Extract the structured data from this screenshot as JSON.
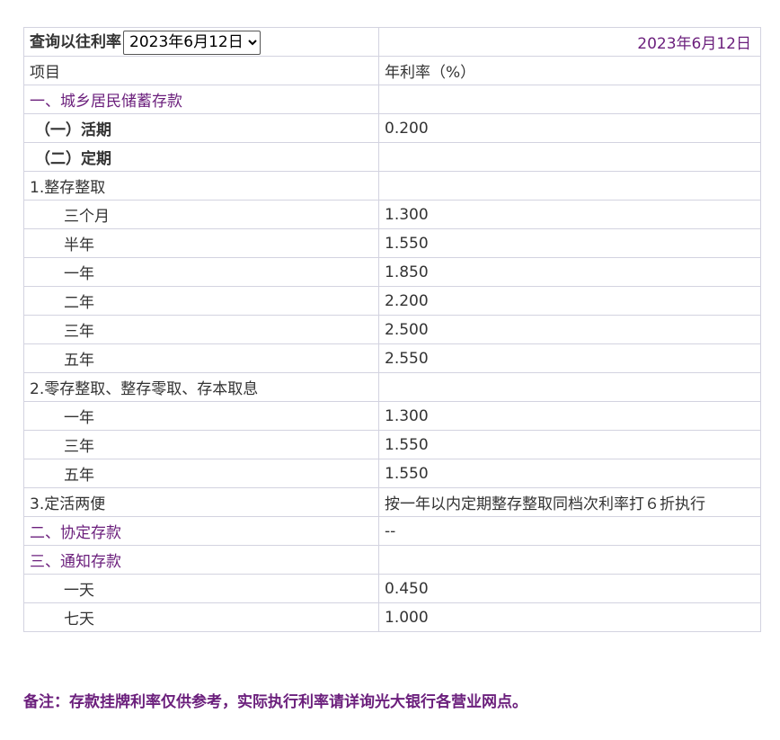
{
  "query": {
    "label": "查询以往利率",
    "selected_date": "2023年6月12日",
    "display_date": "2023年6月12日"
  },
  "header": {
    "item": "项目",
    "rate": "年利率（%）"
  },
  "rows": [
    {
      "name": "一、城乡居民储蓄存款",
      "rate": ""
    },
    {
      "name": "（一）活期",
      "rate": "0.200"
    },
    {
      "name": "（二）定期",
      "rate": ""
    },
    {
      "name": "1.整存整取",
      "rate": ""
    },
    {
      "name": "三个月",
      "rate": "1.300"
    },
    {
      "name": "半年",
      "rate": "1.550"
    },
    {
      "name": "一年",
      "rate": "1.850"
    },
    {
      "name": "二年",
      "rate": "2.200"
    },
    {
      "name": "三年",
      "rate": "2.500"
    },
    {
      "name": "五年",
      "rate": "2.550"
    },
    {
      "name": "2.零存整取、整存零取、存本取息",
      "rate": ""
    },
    {
      "name": "一年",
      "rate": "1.300"
    },
    {
      "name": "三年",
      "rate": "1.550"
    },
    {
      "name": "五年",
      "rate": "1.550"
    },
    {
      "name": "3.定活两便",
      "rate": "按一年以内定期整存整取同档次利率打６折执行"
    },
    {
      "name": "二、协定存款",
      "rate": "--"
    },
    {
      "name": "三、通知存款",
      "rate": ""
    },
    {
      "name": "一天",
      "rate": "0.450"
    },
    {
      "name": "七天",
      "rate": "1.000"
    }
  ],
  "note": "备注：存款挂牌利率仅供参考，实际执行利率请详询光大银行各营业网点。",
  "colors": {
    "accent_purple": "#6b1f7c",
    "border": "#d3d3e0",
    "text": "#333333"
  }
}
